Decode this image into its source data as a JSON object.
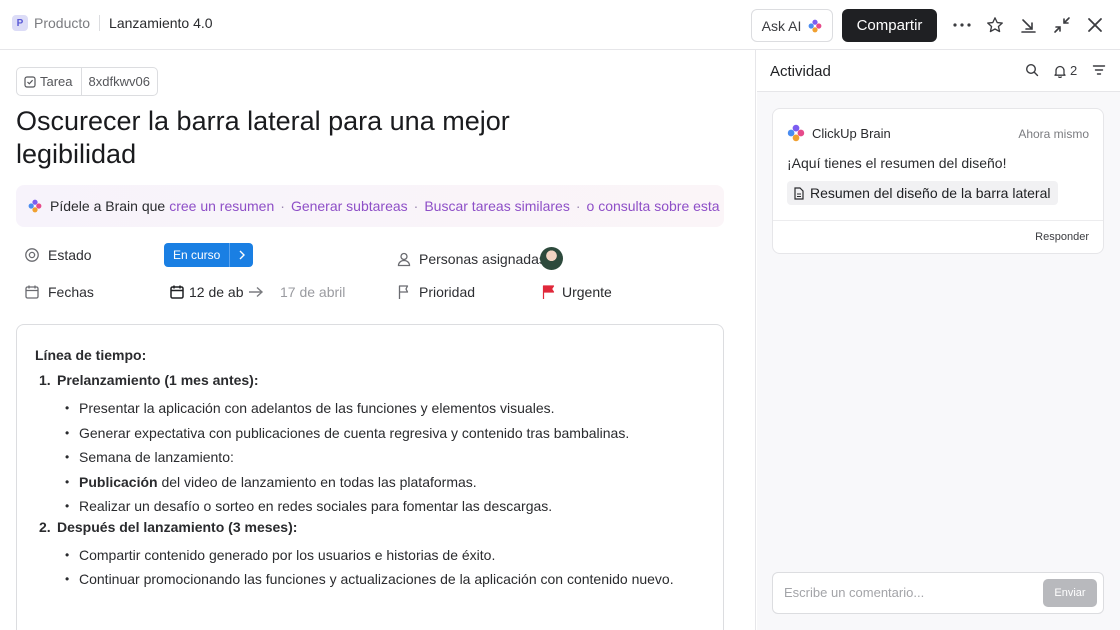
{
  "header": {
    "space_badge": "P",
    "space_name": "Producto",
    "page_name": "Lanzamiento 4.0",
    "ask_ai_label": "Ask AI",
    "share_label": "Compartir",
    "icons": [
      "more-icon",
      "star-icon",
      "minimize-icon",
      "collapse-icon",
      "close-icon"
    ]
  },
  "task": {
    "type_label": "Tarea",
    "task_id": "8xdfkwv06",
    "title": "Oscurecer la barra lateral para una mejor legibilidad"
  },
  "brain_bar": {
    "lead": "Pídele a Brain que",
    "suggestions": [
      "cree un resumen",
      "Generar subtareas",
      "Buscar tareas similares",
      "o consulta sobre esta"
    ],
    "separator": "·"
  },
  "fields": {
    "status_label": "Estado",
    "status_value": "En curso",
    "status_color": "#1a7fe3",
    "assignees_label": "Personas asignadas",
    "dates_label": "Fechas",
    "date_start": "12 de ab",
    "date_end": "17 de abril",
    "priority_label": "Prioridad",
    "priority_value": "Urgente",
    "priority_color": "#e0283a"
  },
  "doc": {
    "heading": "Línea de tiempo:",
    "sections": [
      {
        "num": "1.",
        "title": "Prelanzamiento (1 mes antes):",
        "items": [
          "Presentar la aplicación con adelantos de las funciones y elementos visuales.",
          "Generar expectativa con publicaciones de cuenta regresiva y contenido tras bambalinas.",
          "Semana de lanzamiento:",
          {
            "bold": "Publicación",
            "rest": " del video de lanzamiento en todas las plataformas."
          },
          "Realizar un desafío o sorteo en redes sociales para fomentar las descargas."
        ]
      },
      {
        "num": "2.",
        "title": "Después del lanzamiento (3 meses):",
        "items": [
          "Compartir contenido generado por los usuarios e historias de éxito.",
          "Continuar promocionando las funciones y actualizaciones de la aplicación con contenido nuevo."
        ]
      }
    ]
  },
  "activity": {
    "title": "Actividad",
    "notification_count": "2",
    "card": {
      "author": "ClickUp Brain",
      "time": "Ahora mismo",
      "message": "¡Aquí tienes el resumen del diseño!",
      "attachment": "Resumen del diseño de la barra lateral",
      "reply_label": "Responder"
    },
    "comment_placeholder": "Escribe un comentario...",
    "send_label": "Enviar"
  }
}
